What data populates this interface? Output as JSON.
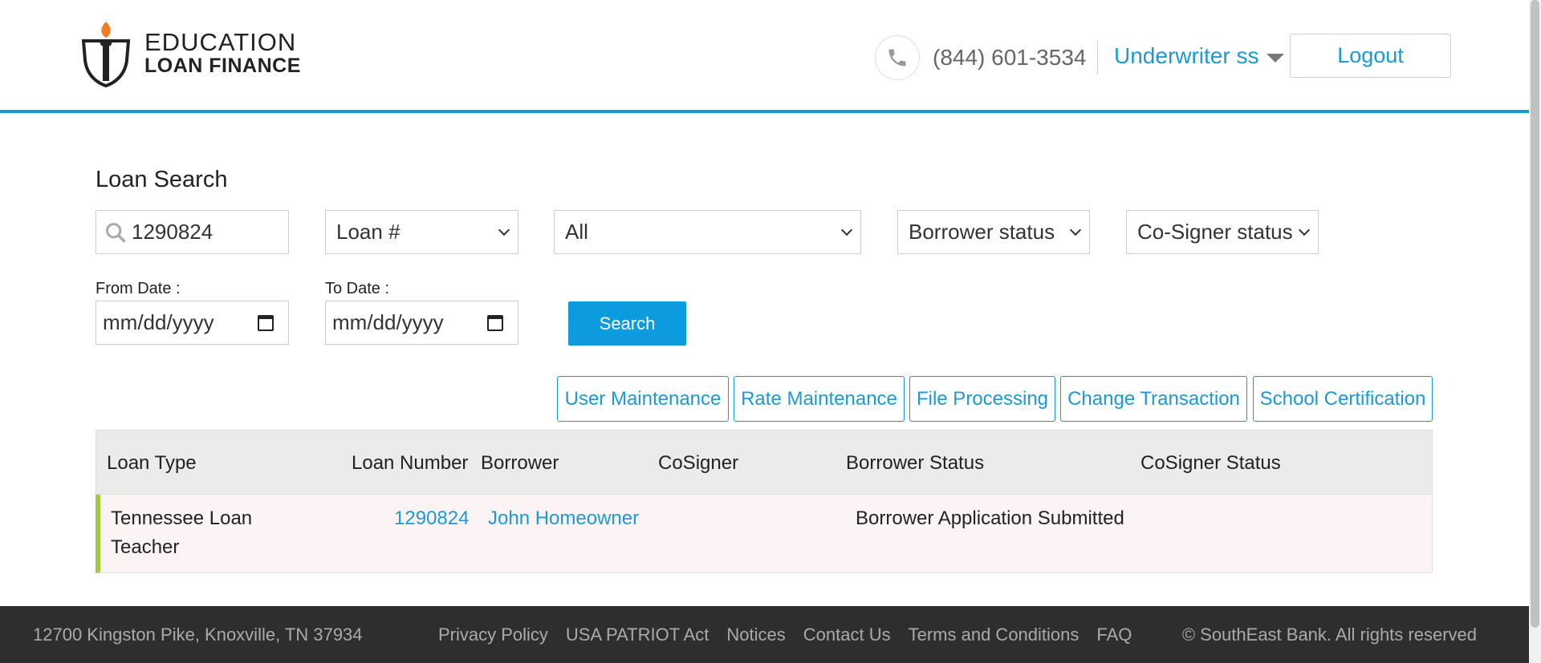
{
  "header": {
    "logo_line1": "EDUCATION",
    "logo_line2": "LOAN FINANCE",
    "phone": "(844) 601-3534",
    "user_menu_label": "Underwriter ss",
    "logout_label": "Logout"
  },
  "search": {
    "title": "Loan Search",
    "query_value": "1290824",
    "search_by_selected": "Loan #",
    "loan_type_selected": "All",
    "borrower_status_selected": "Borrower status",
    "cosigner_status_selected": "Co-Signer status",
    "from_date_label": "From Date :",
    "to_date_label": "To Date :",
    "date_placeholder": "mm/dd/yyyy",
    "search_button": "Search"
  },
  "actions": [
    "User Maintenance",
    "Rate Maintenance",
    "File Processing",
    "Change Transaction",
    "School Certification"
  ],
  "table": {
    "columns": [
      "Loan Type",
      "Loan Number",
      "Borrower",
      "CoSigner",
      "Borrower Status",
      "CoSigner Status"
    ],
    "rows": [
      {
        "loan_type_line1": "Tennessee Loan",
        "loan_type_line2": "Teacher",
        "loan_number": "1290824",
        "borrower": "John Homeowner",
        "cosigner": "",
        "borrower_status": "Borrower Application Submitted",
        "cosigner_status": ""
      }
    ]
  },
  "footer": {
    "address": "12700 Kingston Pike, Knoxville, TN 37934",
    "links": [
      "Privacy Policy",
      "USA PATRIOT Act",
      "Notices",
      "Contact Us",
      "Terms and Conditions",
      "FAQ"
    ],
    "copyright": "© SouthEast Bank. All rights reserved"
  },
  "colors": {
    "accent": "#1a9ad6",
    "search_button": "#0d9be0",
    "row_indicator": "#a5c83c",
    "row_background": "#fcf4f4",
    "footer_background": "#2e2e2e",
    "logo_flame": "#f47b20"
  },
  "icons": {
    "logo": "torch-shield-icon",
    "phone": "phone-icon",
    "search": "search-icon",
    "dropdown": "chevron-down-icon",
    "calendar": "calendar-icon",
    "user_menu": "caret-down-icon"
  }
}
